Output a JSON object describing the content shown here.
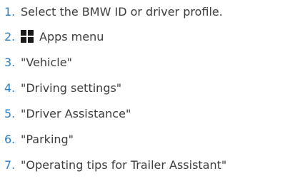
{
  "steps": [
    {
      "number": "1.",
      "text": "Select the BMW ID or driver profile."
    },
    {
      "number": "2.",
      "icon": "apps-grid-icon",
      "text": "Apps menu"
    },
    {
      "number": "3.",
      "text": "\"Vehicle\""
    },
    {
      "number": "4.",
      "text": "\"Driving settings\""
    },
    {
      "number": "5.",
      "text": "\"Driver Assistance\""
    },
    {
      "number": "6.",
      "text": "\"Parking\""
    },
    {
      "number": "7.",
      "text": "\"Operating tips for Trailer Assistant\""
    }
  ],
  "colors": {
    "number": "#2a7fc4",
    "text": "#3c3c3c",
    "icon": "#1a1a1a"
  }
}
